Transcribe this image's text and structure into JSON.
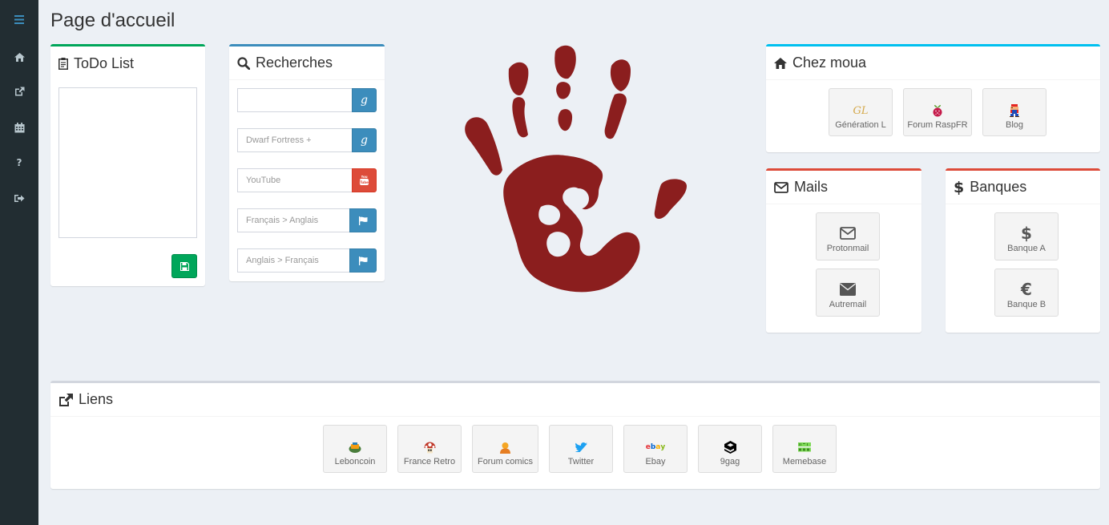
{
  "page": {
    "title": "Page d'accueil"
  },
  "sidebar": {
    "items": [
      {
        "icon": "menu-icon"
      },
      {
        "icon": "home-icon"
      },
      {
        "icon": "external-link-icon"
      },
      {
        "icon": "calendar-icon"
      },
      {
        "icon": "question-icon"
      },
      {
        "icon": "sign-out-icon"
      }
    ]
  },
  "todo": {
    "title": "ToDo List",
    "content": ""
  },
  "search": {
    "title": "Recherches",
    "rows": [
      {
        "placeholder": "",
        "button": "g"
      },
      {
        "placeholder": "Dwarf Fortress +",
        "button": "g"
      },
      {
        "placeholder": "YouTube",
        "button": "youtube-icon"
      },
      {
        "placeholder": "Français > Anglais",
        "button": "flag-icon"
      },
      {
        "placeholder": "Anglais > Français",
        "button": "flag-icon"
      }
    ]
  },
  "chez_moua": {
    "title": "Chez moua",
    "links": [
      {
        "label": "Génération L",
        "icon": "gl-logo-icon"
      },
      {
        "label": "Forum RaspFR",
        "icon": "raspberry-icon"
      },
      {
        "label": "Blog",
        "icon": "mario-icon"
      }
    ]
  },
  "mails": {
    "title": "Mails",
    "links": [
      {
        "label": "Protonmail",
        "icon": "envelope-outline-icon"
      },
      {
        "label": "Autremail",
        "icon": "envelope-icon"
      }
    ]
  },
  "banques": {
    "title": "Banques",
    "links": [
      {
        "label": "Banque A",
        "icon": "dollar-icon"
      },
      {
        "label": "Banque B",
        "icon": "euro-icon"
      }
    ]
  },
  "liens": {
    "title": "Liens",
    "links": [
      {
        "label": "Leboncoin",
        "icon": "leboncoin-icon"
      },
      {
        "label": "France Retro",
        "icon": "mushroom-icon"
      },
      {
        "label": "Forum comics",
        "icon": "comics-icon"
      },
      {
        "label": "Twitter",
        "icon": "twitter-icon"
      },
      {
        "label": "Ebay",
        "icon": "ebay-icon"
      },
      {
        "label": "9gag",
        "icon": "9gag-icon"
      },
      {
        "label": "Memebase",
        "icon": "memebase-icon"
      }
    ]
  },
  "colors": {
    "sidebar": "#222d32",
    "green": "#00a65a",
    "blue": "#3c8dbc",
    "aqua": "#00c0ef",
    "red": "#dd4b39",
    "hand": "#8b1e1e"
  }
}
